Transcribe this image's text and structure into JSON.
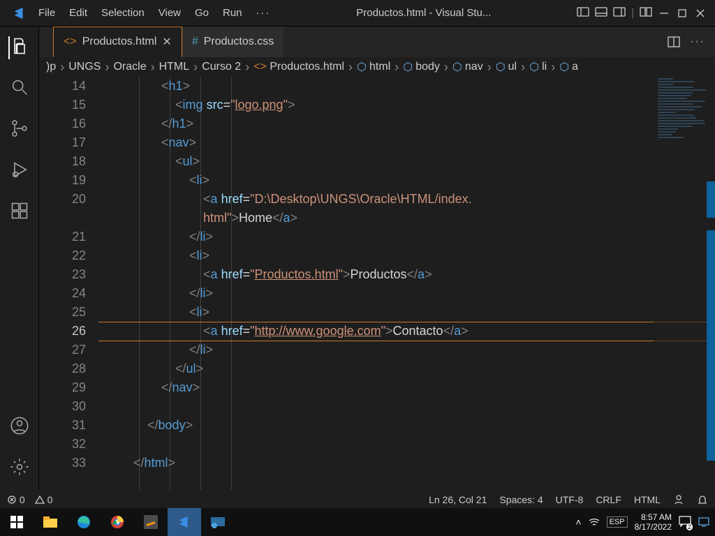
{
  "titlebar": {
    "menus": [
      "File",
      "Edit",
      "Selection",
      "View",
      "Go",
      "Run"
    ],
    "overflow": "···",
    "title": "Productos.html - Visual Stu..."
  },
  "tabs": [
    {
      "icon": "<>",
      "label": "Productos.html",
      "active": true,
      "closable": true
    },
    {
      "icon": "#",
      "label": "Productos.css",
      "active": false,
      "closable": false
    }
  ],
  "breadcrumbs": {
    "path": [
      ")p",
      "UNGS",
      "Oracle",
      "HTML",
      "Curso 2"
    ],
    "file_icon": "<>",
    "file": "Productos.html",
    "outline": [
      "html",
      "body",
      "nav",
      "ul",
      "li",
      "a"
    ]
  },
  "editor": {
    "first_line": 14,
    "lines": [
      {
        "n": 14,
        "indent": 4,
        "raw": "<h1>"
      },
      {
        "n": 15,
        "indent": 5,
        "raw": "<img src=\"logo.png\">",
        "img_src": "logo.png"
      },
      {
        "n": 16,
        "indent": 4,
        "raw": "</h1>"
      },
      {
        "n": 17,
        "indent": 4,
        "raw": "<nav>"
      },
      {
        "n": 18,
        "indent": 5,
        "raw": "<ul>"
      },
      {
        "n": 19,
        "indent": 6,
        "raw": "<li>"
      },
      {
        "n": 20,
        "indent": 7,
        "raw": "<a href=\"D:\\Desktop\\UNGS\\Oracle\\HTML/index.",
        "href1": "D:\\Desktop\\UNGS\\Oracle\\HTML/index."
      },
      {
        "n": "20b",
        "indent": 7,
        "raw": "html\">Home</a>",
        "hrefcont": "html",
        "text": "Home"
      },
      {
        "n": 21,
        "indent": 6,
        "raw": "</li>"
      },
      {
        "n": 22,
        "indent": 6,
        "raw": "<li>"
      },
      {
        "n": 23,
        "indent": 7,
        "raw": "<a href=\"Productos.html\">Productos</a>",
        "href": "Productos.html",
        "text": "Productos"
      },
      {
        "n": 24,
        "indent": 6,
        "raw": "</li>"
      },
      {
        "n": 25,
        "indent": 6,
        "raw": "<li>"
      },
      {
        "n": 26,
        "indent": 7,
        "raw": "<a href=\"http://www.google.com\">Contacto</a>",
        "href": "http://www.google.com",
        "text": "Contacto",
        "current": true
      },
      {
        "n": 27,
        "indent": 6,
        "raw": "</li>"
      },
      {
        "n": 28,
        "indent": 5,
        "raw": "</ul>"
      },
      {
        "n": 29,
        "indent": 4,
        "raw": "</nav>"
      },
      {
        "n": 30,
        "indent": 4,
        "raw": ""
      },
      {
        "n": 31,
        "indent": 3,
        "raw": "</body>"
      },
      {
        "n": 32,
        "indent": 0,
        "raw": ""
      },
      {
        "n": 33,
        "indent": 2,
        "raw": "</html>"
      }
    ]
  },
  "statusbar": {
    "errors": "0",
    "warnings": "0",
    "cursor": "Ln 26, Col 21",
    "spaces": "Spaces: 4",
    "encoding": "UTF-8",
    "eol": "CRLF",
    "lang": "HTML"
  },
  "taskbar": {
    "lang": "ESP",
    "time": "8:57 AM",
    "date": "8/17/2022",
    "notif": "2"
  }
}
